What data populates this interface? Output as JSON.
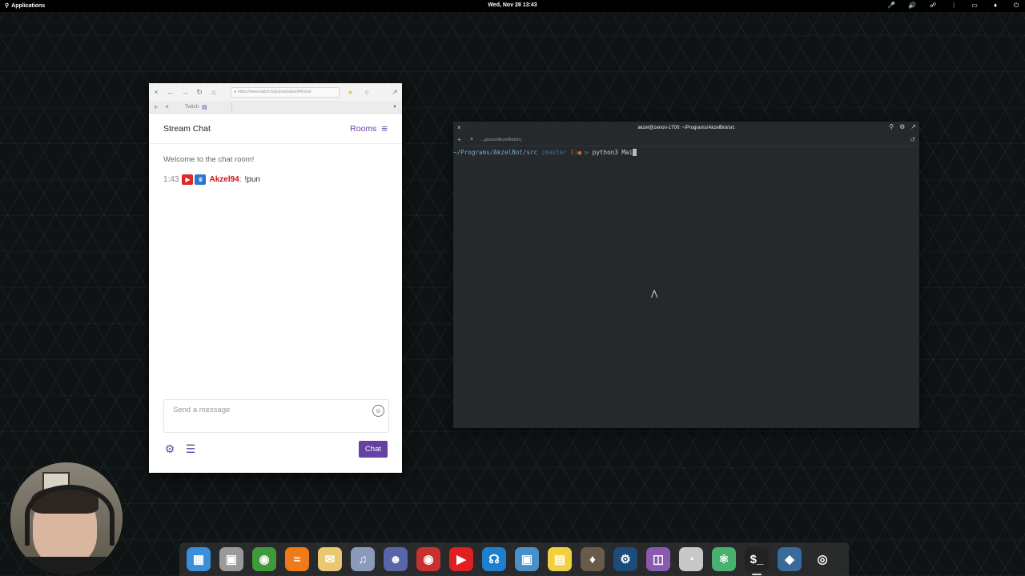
{
  "topbar": {
    "applications_label": "Applications",
    "datetime": "Wed, Nov 28   13:43",
    "indicators": [
      "mic-icon",
      "volume-icon",
      "network-icon",
      "bluetooth-icon",
      "battery-icon",
      "notifications-icon",
      "power-icon"
    ]
  },
  "browser": {
    "url": "https://www.twitch.tv/popout/akzel94/chat",
    "tab_title": "Twitch",
    "chat": {
      "header_title": "Stream Chat",
      "rooms_label": "Rooms",
      "welcome": "Welcome to the chat room!",
      "message": {
        "time": "1:43",
        "username": "Akzel94",
        "text": "!pun"
      },
      "input_placeholder": "Send a message",
      "send_label": "Chat"
    }
  },
  "terminal": {
    "title": "akzel@zenon-1700: ~/Programs/AkzelBot/src",
    "tab_label": "...grams/AkzelBot/src",
    "prompt_path": "~/Programs/AkzelBot/src",
    "prompt_branch_open": "(master ",
    "prompt_branch_mark": "X",
    "prompt_branch_close": ")",
    "command": "python3 Mai"
  },
  "dock": {
    "apps": [
      {
        "name": "multitasking-view-icon",
        "color": "#3a8fd9"
      },
      {
        "name": "files-icon",
        "color": "#9a9a9a"
      },
      {
        "name": "browser-icon",
        "color": "#3f9a3a"
      },
      {
        "name": "rss-reader-icon",
        "color": "#f07a1a"
      },
      {
        "name": "mail-icon",
        "color": "#e8c870"
      },
      {
        "name": "music-icon",
        "color": "#8a9ab8"
      },
      {
        "name": "discord-icon",
        "color": "#5865a8"
      },
      {
        "name": "screen-recorder-icon",
        "color": "#c83030"
      },
      {
        "name": "youtube-icon",
        "color": "#e02020"
      },
      {
        "name": "podcasts-icon",
        "color": "#1f7fcf"
      },
      {
        "name": "photos-icon",
        "color": "#4a90c8"
      },
      {
        "name": "notes-icon",
        "color": "#f0d040"
      },
      {
        "name": "game-icon",
        "color": "#6a5a4a"
      },
      {
        "name": "steam-icon",
        "color": "#1b4c7a"
      },
      {
        "name": "appcenter-icon",
        "color": "#8a5ab0"
      },
      {
        "name": "switchboard-icon",
        "color": "#c8c8c8"
      },
      {
        "name": "atom-icon",
        "color": "#4ab070"
      },
      {
        "name": "terminal-icon",
        "color": "#222222"
      },
      {
        "name": "davinci-resolve-icon",
        "color": "#3a6a9a"
      },
      {
        "name": "obs-icon",
        "color": "#2a2a2a"
      }
    ]
  }
}
